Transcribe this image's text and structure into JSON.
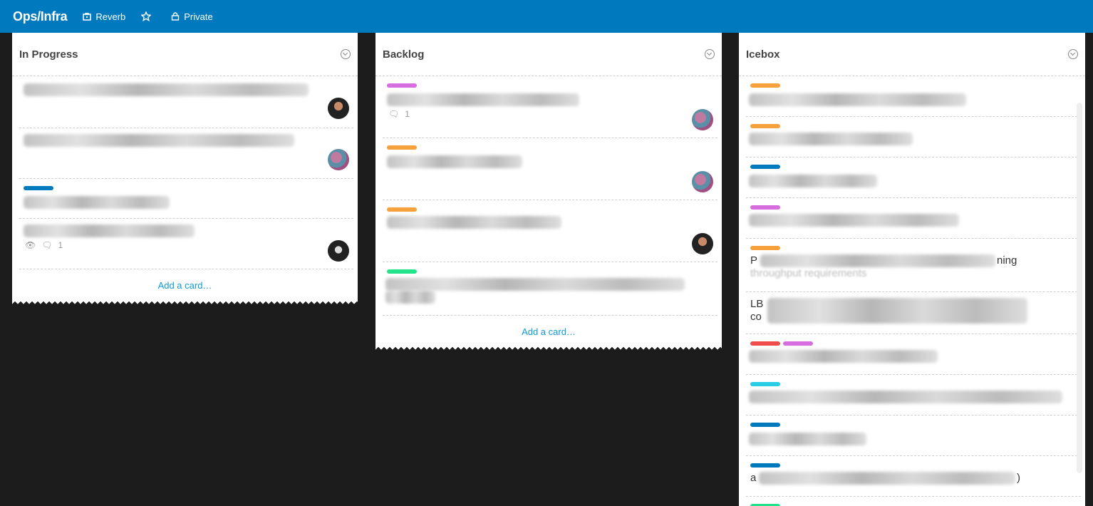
{
  "header": {
    "board_title": "Ops/Infra",
    "team_label": "Reverb",
    "visibility_label": "Private",
    "icons": [
      "team-icon",
      "star-icon",
      "lock-icon"
    ],
    "color": "#0079bf"
  },
  "lists": [
    {
      "title": "In Progress",
      "add_card": "Add a card…",
      "cards": [
        {
          "labels": [],
          "avatar": "dark"
        },
        {
          "labels": [],
          "avatar": "color"
        },
        {
          "labels": [
            "#0079bf"
          ]
        },
        {
          "labels": [],
          "comments": "1",
          "watch": true,
          "avatar": "bw"
        }
      ]
    },
    {
      "title": "Backlog",
      "add_card": "Add a card…",
      "cards": [
        {
          "labels": [
            "#d76ee0"
          ],
          "comments": "1",
          "avatar": "color"
        },
        {
          "labels": [
            "#f6a13c"
          ],
          "avatar": "color"
        },
        {
          "labels": [
            "#f6a13c"
          ],
          "avatar": "dark"
        },
        {
          "labels": [
            "#23e38b"
          ]
        }
      ]
    },
    {
      "title": "Icebox",
      "cards": [
        {
          "labels": [
            "#f6a13c"
          ]
        },
        {
          "labels": [
            "#f6a13c"
          ]
        },
        {
          "labels": [
            "#0079bf"
          ]
        },
        {
          "labels": [
            "#d76ee0"
          ]
        },
        {
          "labels": [
            "#f6a13c"
          ],
          "visible_start": "P",
          "visible_end": "ning",
          "visible_line2": "throughput requirements"
        },
        {
          "labels": [],
          "visible_start": "LB",
          "visible_line2": "co"
        },
        {
          "labels": [
            "#ef4c4c",
            "#d76ee0"
          ]
        },
        {
          "labels": [
            "#29cce5"
          ]
        },
        {
          "labels": [
            "#0079bf"
          ]
        },
        {
          "labels": [
            "#0079bf"
          ],
          "visible_start": "a",
          "visible_end": ")"
        },
        {
          "labels": [
            "#23e38b"
          ]
        }
      ]
    }
  ]
}
